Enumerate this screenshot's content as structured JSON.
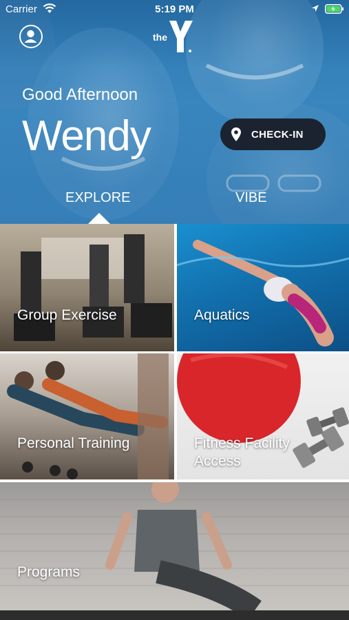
{
  "status_bar": {
    "carrier": "Carrier",
    "time": "5:19 PM"
  },
  "header": {
    "logo_text": "the",
    "greeting": "Good Afternoon",
    "user_name": "Wendy",
    "checkin_label": "CHECK-IN"
  },
  "tabs": [
    {
      "label": "EXPLORE",
      "selected": true
    },
    {
      "label": "VIBE",
      "selected": false
    }
  ],
  "tiles": [
    {
      "label": "Group Exercise"
    },
    {
      "label": "Aquatics"
    },
    {
      "label": "Personal Training"
    },
    {
      "label": "Fitness Facility Access"
    },
    {
      "label": "Programs"
    }
  ],
  "colors": {
    "hero_blue": "#3a87c0",
    "checkin_bg": "#1b2330",
    "battery_green": "#4cd964",
    "fitness_ball_red": "#d8262a"
  },
  "icons": [
    "wifi-icon",
    "location-arrow-icon",
    "battery-icon",
    "profile-icon",
    "ymca-logo",
    "location-pin-icon"
  ]
}
